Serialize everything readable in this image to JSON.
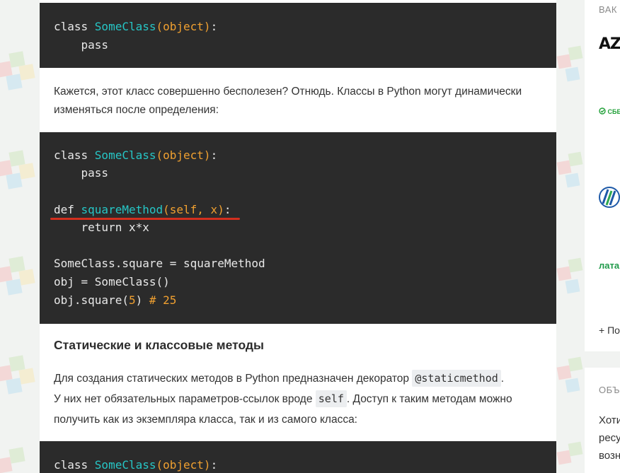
{
  "code_block_1": {
    "kw_class": "class ",
    "class_name": "SomeClass",
    "class_arg": "(object)",
    "colon": ":",
    "pass": "    pass"
  },
  "para_1": "Кажется, этот класс совершенно бесполезен? Отнюдь. Классы в Python могут динамически изменяться после определения:",
  "code_block_2": {
    "kw_class": "class ",
    "class_name": "SomeClass",
    "class_arg": "(object)",
    "colon": ":",
    "pass": "    pass",
    "kw_def": "def ",
    "func_name": "squareMethod",
    "func_args": "(self, x)",
    "func_colon": ":",
    "return_line": "    return x*x",
    "assign_line": "SomeClass.square = squareMethod",
    "obj_line": "obj = SomeClass()",
    "call_prefix": "obj.square(",
    "call_num": "5",
    "call_suffix": ") ",
    "call_comment": "# 25"
  },
  "heading": "Статические и классовые методы",
  "para_2": {
    "line1_text": "Для создания статических методов в Python предназначен декоратор ",
    "line1_code": "@staticmethod",
    "line1_end": ".",
    "line2_text": "У них нет обязательных параметров-ссылок вроде ",
    "line2_code": "self",
    "line2_end": ". Доступ к таким методам можно",
    "line3_text": "получить как из экземпляра класса, так и из самого  класса:"
  },
  "code_block_3": {
    "kw_class": "class ",
    "class_name": "SomeClass",
    "class_arg": "(object)",
    "colon": ":"
  },
  "sidebar": {
    "vacancies_label": "ВАК",
    "logo_az": "AZ",
    "logo_sber": "СБЕ",
    "logo_lat": "лата",
    "more_link": "+ По",
    "section2_label": "ОБЪ",
    "text_line1": "Хоти",
    "text_line2": "ресу",
    "text_line3": "возн"
  },
  "colors": {
    "code_bg": "#2b2b2b",
    "class_name": "#26c6c6",
    "accent_orange": "#f0a030",
    "underline_red": "#d32f1e"
  }
}
